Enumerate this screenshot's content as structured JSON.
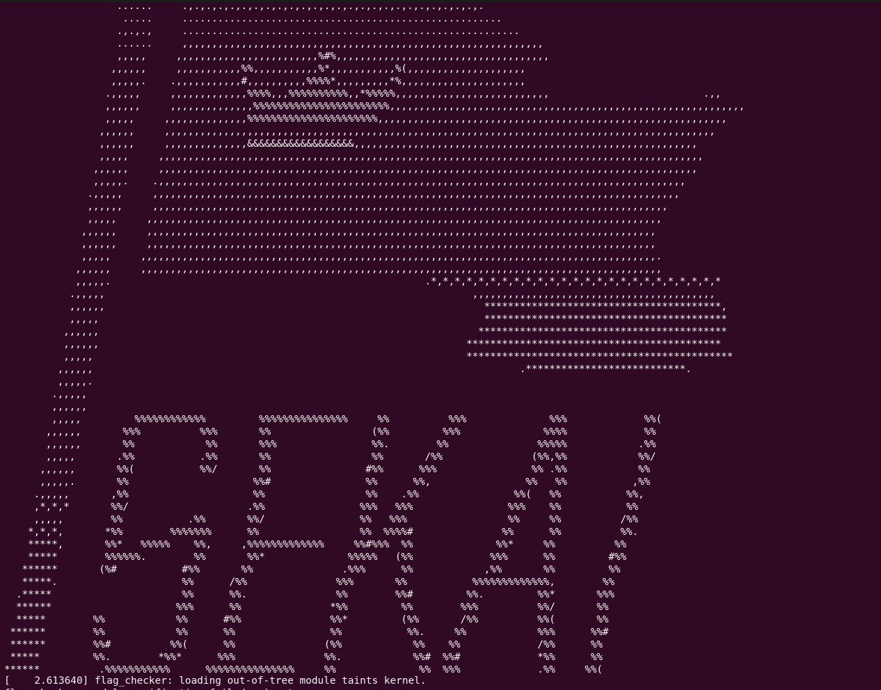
{
  "terminal": {
    "art_lines": [
      "                   ......     .,.,.,.,.,.,.,.,.,.,.,.,.,.,.,.,.,.,.,.,.,.,.,.,.,.",
      "                    .....     ......................................................",
      "                   .,.,.,     .........................................................",
      "                   ......     ,,,,,,,,,,,,,,,,,,,,,,,,,,,,,,,,,,,,,,,,,,,,,,,,,,,,,,,,,,,,,",
      "                   ,,,,,     ,,,,,,,,,,,,,,,,,,,,,,,,%#%,,,,,,,,,,,,,,,,,,,,,,,,,,,,,,,,,,,,",
      "                  ,,,,,,     ,,,,,,,,,,,%%,,,,,,,,,,,%*,,,,,,,,,,,%(,,,,,,,,,,,,,,,,,,,,",
      "                  ,,,,,.    .,,,,,,,,,,,#,,,,,,,,,,%%%%*,,,,,,,,,*%,,,,,,,,,,,,,,,,,,,,,",
      "                 .,,,,,     ,,,,,,,,,,,,,%%%%,,,%%%%%%%%%%,,*%%%%%,,,,,,,,,,,,,,,,,,,,,,,,,,                          .,,",
      "                 ,,,,,,     ,,,,,,,,,,,,,,%%%%%%%%%%%%%%%%%%%%%%%,,,,,,,,,,,,,,,,,,,,,,,,,,,,,,,,,,,,,,,,,,,,,,,,,,,,,,,,,,,,",
      "                 ,,,,,     ,,,,,,,,,,,,,,%%%%%%%%%%%%%%%%%%%%%%,,,,,,,,,,,,,,,,,,,,,,,,,,,,,,,,,,,,,,,,,,,,,,,,,,,,,,,,,,,",
      "                ,,,,,,     ,,,,,,,,,,,,,,,,,,,,,,,,,,,,,,,,,,,,,,,,,,,,,,,,,,,,,,,,,,,,,,,,,,,,,,,,,,,,,,,,,,,,,,,,,,,,,",
      "                ,,,,,,     ,,,,,,,,,,,,,,&&&&&&&&&&&&&&&&&&,,,,,,,,,,,,,,,,,,,,,,,,,,,,,,,,,,,,,,,,,,,,,,,,,,,,,,,,,,",
      "                ,,,,,     ,,,,,,,,,,,,,,,,,,,,,,,,,,,,,,,,,,,,,,,,,,,,,,,,,,,,,,,,,,,,,,,,,,,,,,,,,,,,,,,,,,,,,,,,,,,,",
      "               ,,,,,,     ,,,,,,,,,,,,,,,,,,,,,,,,,,,,,,,,,,,,,,,,,,,,,,,,,,,,,,,,,,,,,,,,,,,,,,,,,,,,,,,,,,,,,,,,,,,",
      "               ,,,,,.    .,,,,,,,,,,,,,,,,,,,,,,,,,,,,,,,,,,,,,,,,,,,,,,,,,,,,,,,,,,,,,,,,,,,,,,,,,,,,,,,,,,,,,,,,,",
      "              .,,,,,     ,,,,,,,,,,,,,,,,,,,,,,,,,,,,,,,,,,,,,,,,,,,,,,,,,,,,,,,,,,,,,,,,,,,,,,,,,,,,,,,,,,,,,,,,,",
      "              ,,,,,,     ,,,,,,,,,,,,,,,,,,,,,,,,,,,,,,,,,,,,,,,,,,,,,,,,,,,,,,,,,,,,,,,,,,,,,,,,,,,,,,,,,,,,,,,",
      "              ,,,,,     ,,,,,,,,,,,,,,,,,,,,,,,,,,,,,,,,,,,,,,,,,,,,,,,,,,,,,,,,,,,,,,,,,,,,,,,,,,,,,,,,,,,,,,,",
      "             ,,,,,,     ,,,,,,,,,,,,,,,,,,,,,,,,,,,,,,,,,,,,,,,,,,,,,,,,,,,,,,,,,,,,,,,,,,,,,,,,,,,,,,,,,,,,,,",
      "             ,,,,,,     ,,,,,,,,,,,,,,,,,,,,,,,,,,,,,,,,,,,,,,,,,,,,,,,,,,,,,,,,,,,,,,,,,,,,,,,,,,,,,,,,,,,,,,",
      "             ,,,,,     ,,,,,,,,,,,,,,,,,,,,,,,,,,,,,,,,,,,,,,,,,,,,,,,,,,,,,,,,,,,,,,,,,,,,,,,,,,,,,,,,,,,,,,,.",
      "            ,,,,,,     ,,,,,,,,,,,,,,,,,,,,,,,,,,,,,,,,,,,,,,,,,,,,,,,,,,,,,,,,,,,,,,,,,,,,,,,,,,,,,,,,,,,,,,,,",
      "            ,,,,,.                                                     .*,*,*,*,*,*,*,*,*,*,*,*,*,*,*,*,*,*,*,*,*,*,*,*,*",
      "           .,,,,,                                                              ,,,,,,,,,,,,,,,,,,,,,,,,,,,,,,,,,,,,,,,,,",
      "           ,,,,,,                                                                ****************************************,",
      "           ,,,,,                                                                 *****************************************",
      "          ,,,,,,                                                                ******************************************",
      "          ,,,,,,                                                              *******************************************",
      "          ,,,,,                                                               *********************************************",
      "         ,,,,,,                                                                        .***************************.",
      "         ,,,,,.",
      "        .,,,,,",
      "        ,,,,,,",
      "        ,,,,,         %%%%%%%%%%%%         %%%%%%%%%%%%%%%     %%          %%%              %%%             %%(",
      "       ,,,,,,       %%%          %%%       %%                 (%%         %%%              %%%%             %%",
      "       ,,,,,,       %%            %%       %%%                %%.        %%               %%%%%            .%%",
      "       ,,,,,       .%%           .%%       %%                 %%       /%%               (%%,%%            %%/",
      "      ,,,,,,       %%(           %%/       %%                #%%      %%%                %% .%%            %%",
      "      ,,,,,.       %%                     %%#                %%      %%,                %%   %%           ,%%",
      "     .,,,,,       ,%%                     %%                 %%    .%%                %%(   %%           %%,",
      "     ,*,*,*       %%/                    .%%                %%%   %%%                %%%    %%           %%",
      "     ,,,,,        %%           .%%       %%/                %%   %%%                 %%     %%          /%%",
      "    *,*,*,       *%%        %%%%%%%      %%                 %%  %%%%#               %%      %%          %%.",
      "    *****,       %%*   %%%%%    %%,     ,%%%%%%%%%%%%%     %%#%%%  %%              %%*     %%          %%",
      "    *****        %%%%%%.        %%       %%*              %%%%%   (%%             %%%      %%         #%%",
      "   ******       (%#           #%%       %%               .%%%      %%            ,%%       %%         %%",
      "   *****.                     %%      /%%               %%%       %%           %%%%%%%%%%%%%,        %%",
      "  .*****                      %%      %%.               %%        %%#         %%.         %%*       %%%",
      "  ******                     %%%      %%               *%%         %%        %%%          %%/       %%",
      "  *****        %%            %%      #%%               %%*         (%%       /%%          %%(       %%",
      " ******        %%            %%      %%                %%           %%.     %%            %%%      %%#",
      " ******        %%#          %%(      %%               (%%            %%    %%             /%%      %%",
      " *****         %%.        *%%*      %%%               %%.            %%#  %%#             *%%      %%",
      "******          .%%%%%%%%%%%      %%%%%%%%%%%%%%%     %%              %%  %%%             .%%     %%("
    ],
    "log_line": "[    2.613640] flag_checker: loading out-of-tree module taints kernel.",
    "cut_line": "flag_checker: module verification failed: signature"
  }
}
